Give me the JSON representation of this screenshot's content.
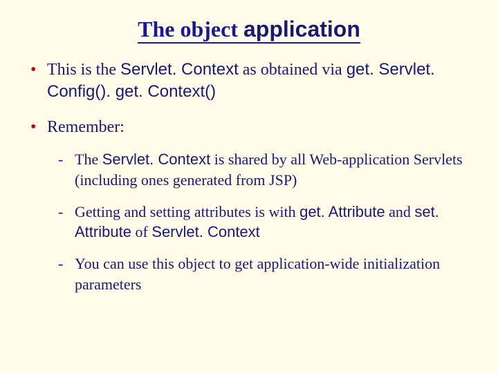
{
  "title_part1": "The object ",
  "title_part2": "application",
  "bullet1_a": "This is the ",
  "bullet1_b": "Servlet. Context",
  "bullet1_c": " as obtained via ",
  "bullet1_d": "get. Servlet. Config(). get. Context()",
  "bullet2": "Remember:",
  "sub1_a": "The ",
  "sub1_b": "Servlet. Context",
  "sub1_c": " is shared by all Web-application Servlets (including ones generated from JSP)",
  "sub2_a": "Getting and setting attributes is with ",
  "sub2_b": "get. Attribute",
  "sub2_c": " and ",
  "sub2_d": "set. Attribute",
  "sub2_e": " of ",
  "sub2_f": "Servlet. Context",
  "sub3": "You can use this object to get application-wide initialization parameters"
}
